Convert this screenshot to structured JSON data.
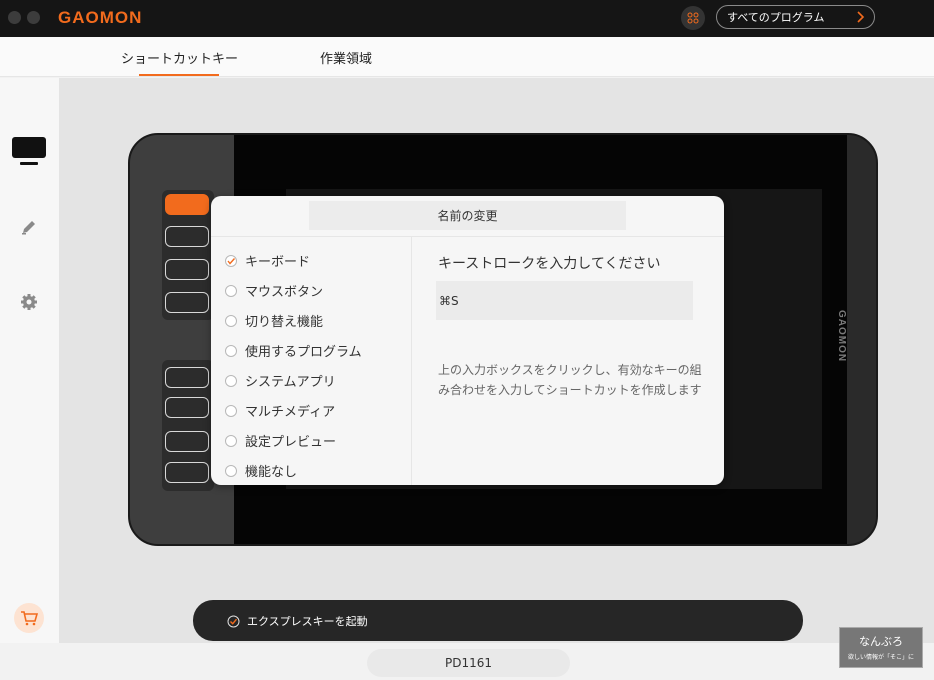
{
  "app": {
    "logo_text": "GAOMON",
    "accent": "#f26b1d"
  },
  "header": {
    "all_programs_label": "すべてのプログラム"
  },
  "tabs": [
    {
      "label": "ショートカットキー",
      "active": true
    },
    {
      "label": "作業領域",
      "active": false
    }
  ],
  "tablet": {
    "brand": "GAOMON"
  },
  "dialog": {
    "title": "名前の変更",
    "options": [
      {
        "label": "キーボード",
        "checked": true
      },
      {
        "label": "マウスボタン",
        "checked": false
      },
      {
        "label": "切り替え機能",
        "checked": false
      },
      {
        "label": "使用するプログラム",
        "checked": false
      },
      {
        "label": "システムアプリ",
        "checked": false
      },
      {
        "label": "マルチメディア",
        "checked": false
      },
      {
        "label": "設定プレビュー",
        "checked": false
      },
      {
        "label": "機能なし",
        "checked": false
      }
    ],
    "heading": "キーストロークを入力してください",
    "input_value": "⌘S",
    "help_text": "上の入力ボックスをクリックし、有効なキーの組み合わせを入力してショートカットを作成します"
  },
  "express": {
    "label": "エクスプレスキーを起動",
    "checked": true
  },
  "footer": {
    "model": "PD1161"
  },
  "watermark": {
    "title": "なんぶろ",
    "subtitle": "欲しい情報が「そこ」に"
  }
}
